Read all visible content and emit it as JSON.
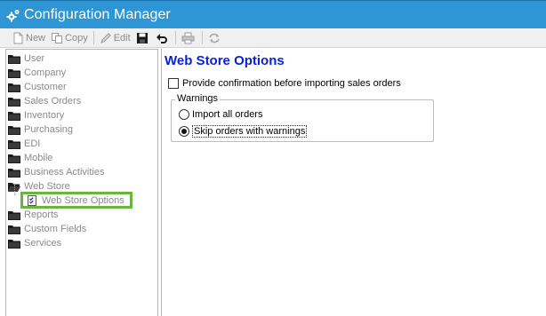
{
  "window": {
    "title": "Configuration Manager",
    "title_icon": "gear-icon",
    "titlebar_color": "#2f96d6"
  },
  "toolbar": {
    "new_label": "New",
    "copy_label": "Copy",
    "edit_label": "Edit"
  },
  "tree": {
    "items": [
      {
        "label": "User"
      },
      {
        "label": "Company"
      },
      {
        "label": "Customer"
      },
      {
        "label": "Sales Orders"
      },
      {
        "label": "Inventory"
      },
      {
        "label": "Purchasing"
      },
      {
        "label": "EDI"
      },
      {
        "label": "Mobile"
      },
      {
        "label": "Business Activities"
      },
      {
        "label": "Web Store"
      },
      {
        "label": "Reports"
      },
      {
        "label": "Custom Fields"
      },
      {
        "label": "Services"
      }
    ],
    "selected_child": {
      "label": "Web Store Options",
      "highlight_color": "#6cb33f"
    }
  },
  "main": {
    "heading": "Web Store Options",
    "heading_color": "#0a1edb",
    "confirm_checkbox": {
      "label": "Provide confirmation before importing sales orders",
      "checked": false
    },
    "warnings_group": {
      "label": "Warnings",
      "options": [
        {
          "label": "Import all orders",
          "selected": false
        },
        {
          "label": "Skip orders with warnings",
          "selected": true
        }
      ]
    }
  }
}
